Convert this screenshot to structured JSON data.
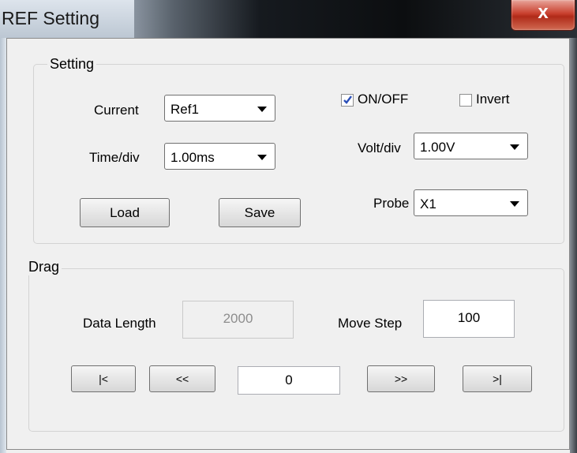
{
  "window": {
    "title": "REF Setting",
    "close_glyph": "x"
  },
  "setting_group": {
    "legend": "Setting",
    "current_label": "Current",
    "current_value": "Ref1",
    "timediv_label": "Time/div",
    "timediv_value": "1.00ms",
    "onoff_label": "ON/OFF",
    "onoff_checked": true,
    "invert_label": "Invert",
    "invert_checked": false,
    "voltdiv_label": "Volt/div",
    "voltdiv_value": "1.00V",
    "probe_label": "Probe",
    "probe_value": "X1",
    "load_label": "Load",
    "save_label": "Save"
  },
  "drag_group": {
    "legend": "Drag",
    "data_length_label": "Data Length",
    "data_length_value": "2000",
    "move_step_label": "Move Step",
    "move_step_value": "100",
    "first_label": "|<",
    "prev_label": "<<",
    "position_value": "0",
    "next_label": ">>",
    "last_label": ">|"
  },
  "icons": {
    "close": "close-icon",
    "dropdown": "chevron-down-icon",
    "check": "check-icon"
  }
}
